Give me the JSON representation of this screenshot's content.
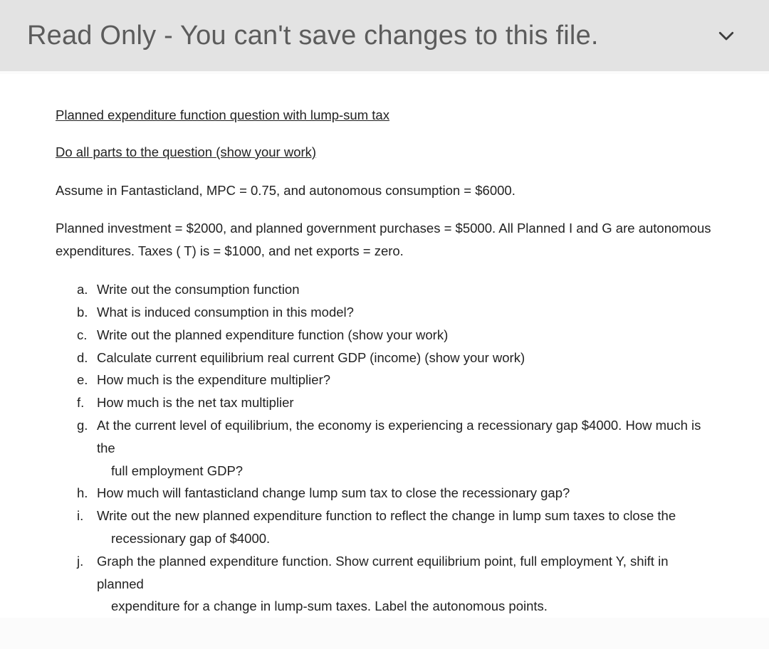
{
  "banner": {
    "text": "Read Only - You can't save changes to this file."
  },
  "doc": {
    "heading1": "Planned expenditure function question with lump-sum tax",
    "heading2": "Do all parts to the question (show your work)",
    "p1": "Assume in Fantasticland, MPC = 0.75, and autonomous consumption = $6000.",
    "p2": "Planned investment = $2000, and planned government purchases =  $5000. All Planned I and G are autonomous expenditures. Taxes ( T) is = $1000, and net exports = zero.",
    "items": [
      {
        "marker": "a.",
        "text": " Write out the consumption function",
        "sub": ""
      },
      {
        "marker": "b.",
        "text": "What is induced consumption in this model?",
        "sub": ""
      },
      {
        "marker": "c.",
        "text": "Write out the planned expenditure function (show your work)",
        "sub": ""
      },
      {
        "marker": "d.",
        "text": "Calculate current equilibrium real current GDP (income) (show your work)",
        "sub": ""
      },
      {
        "marker": "e.",
        "text": "How much is the expenditure multiplier?",
        "sub": ""
      },
      {
        "marker": "f.",
        "text": "How much is the net tax multiplier",
        "sub": ""
      },
      {
        "marker": "g.",
        "text": "At the current level of equilibrium, the economy is experiencing a recessionary gap $4000. How much is the",
        "sub": "full employment GDP?"
      },
      {
        "marker": "h.",
        "text": "How much will fantasticland change lump sum tax to close the recessionary gap?",
        "sub": ""
      },
      {
        "marker": "i.",
        "text": "Write out the new planned expenditure function to reflect the change in lump sum taxes to close the",
        "sub": "recessionary gap of $4000."
      },
      {
        "marker": "j.",
        "text": "Graph the planned expenditure function. Show current equilibrium point, full employment Y, shift in planned",
        "sub": "expenditure for a change in lump-sum taxes. Label the autonomous points."
      }
    ]
  }
}
